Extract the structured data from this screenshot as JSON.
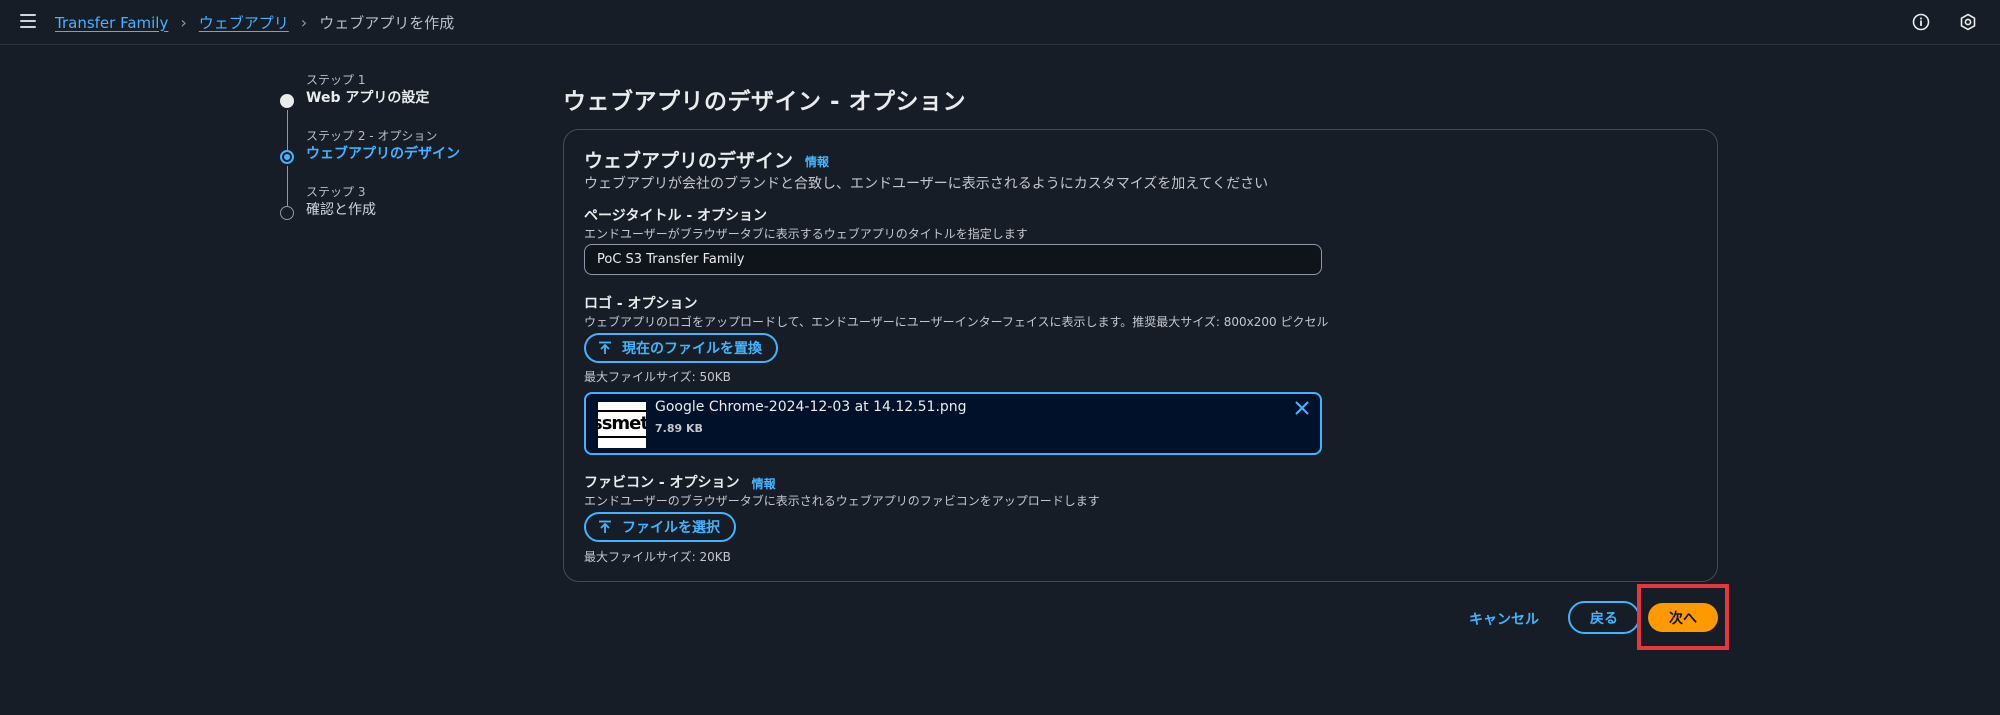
{
  "breadcrumb": {
    "items": [
      "Transfer Family",
      "ウェブアプリ"
    ],
    "current": "ウェブアプリを作成"
  },
  "icons": {
    "menu": "hamburger-icon",
    "info": "info-icon",
    "settings": "settings-icon",
    "upload": "upload-icon",
    "close": "close-icon"
  },
  "steps": [
    {
      "number": "ステップ 1",
      "label": "Web アプリの設定",
      "state": "done"
    },
    {
      "number": "ステップ 2 - オプション",
      "label": "ウェブアプリのデザイン",
      "state": "active"
    },
    {
      "number": "ステップ 3",
      "label": "確認と作成",
      "state": "todo"
    }
  ],
  "page": {
    "title": "ウェブアプリのデザイン - オプション"
  },
  "container": {
    "header": "ウェブアプリのデザイン",
    "info_label": "情報",
    "description": "ウェブアプリが会社のブランドと合致し、エンドユーザーに表示されるようにカスタマイズを加えてください"
  },
  "page_title_field": {
    "label": "ページタイトル - オプション",
    "description": "エンドユーザーがブラウザータブに表示するウェブアプリのタイトルを指定します",
    "value": "PoC S3 Transfer Family"
  },
  "logo_field": {
    "label": "ロゴ - オプション",
    "description": "ウェブアプリのロゴをアップロードして、エンドユーザーにユーザーインターフェイスに表示します。推奨最大サイズ: 800x200 ピクセル",
    "button": "現在のファイルを置換",
    "constraint": "最大ファイルサイズ: 50KB",
    "file": {
      "name": "Google Chrome-2024-12-03 at 14.12.51.png",
      "size": "7.89 KB",
      "thumb_text": "ssmeti"
    }
  },
  "favicon_field": {
    "label": "ファビコン - オプション",
    "info_label": "情報",
    "description": "エンドユーザーのブラウザータブに表示されるウェブアプリのファビコンをアップロードします",
    "button": "ファイルを選択",
    "constraint": "最大ファイルサイズ: 20KB"
  },
  "actions": {
    "cancel": "キャンセル",
    "back": "戻る",
    "next": "次へ"
  },
  "colors": {
    "background": "#161d26",
    "link": "#42b4ff",
    "primary_button": "#ff9900",
    "highlight": "#e8363f"
  }
}
